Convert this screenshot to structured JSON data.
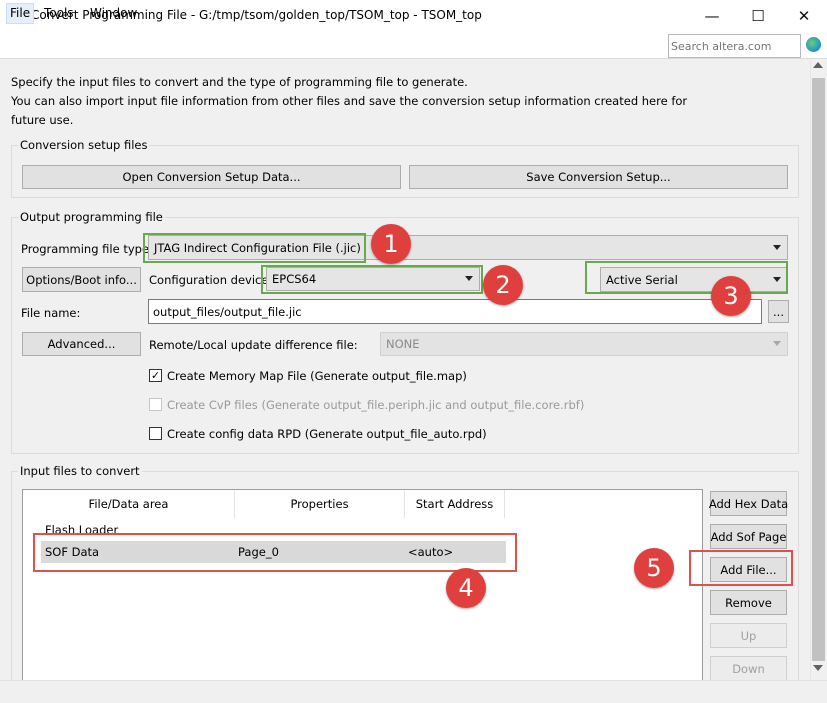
{
  "window": {
    "title": "Convert Programming File - G:/tmp/tsom/golden_top/TSOM_top - TSOM_top",
    "minimize_glyph": "—",
    "maximize_glyph": "☐",
    "close_glyph": "✕"
  },
  "menu": {
    "items": [
      "File",
      "Tools",
      "Window"
    ],
    "search_placeholder": "Search altera.com"
  },
  "intro": {
    "line1": "Specify the input files to convert and the type of programming file to generate.",
    "line2": "You can also import input file information from other files and save the conversion setup information created here for",
    "line3": "future use."
  },
  "conversion_setup": {
    "title": "Conversion setup files",
    "open_button": "Open Conversion Setup Data...",
    "save_button": "Save Conversion Setup..."
  },
  "output": {
    "title": "Output programming file",
    "file_type_label": "Programming file type:",
    "file_type_value": "JTAG Indirect Configuration File (.jic)",
    "options_button": "Options/Boot info...",
    "config_device_label": "Configuration device:",
    "config_device_value": "EPCS64",
    "mode_value": "Active Serial",
    "file_name_label": "File name:",
    "file_name_value": "output_files/output_file.jic",
    "browse_button": "...",
    "advanced_button": "Advanced...",
    "remote_label": "Remote/Local update difference file:",
    "remote_value": "NONE",
    "memory_map_label": "Create Memory Map File (Generate output_file.map)",
    "memory_map_checked": "✓",
    "cvp_label": "Create CvP files (Generate output_file.periph.jic and output_file.core.rbf)",
    "rpd_label": "Create config data RPD (Generate output_file_auto.rpd)"
  },
  "input_files": {
    "title": "Input files to convert",
    "columns": [
      "File/Data area",
      "Properties",
      "Start Address"
    ],
    "tree_root": "Flash Loader",
    "row": {
      "name": "SOF Data",
      "properties": "Page_0",
      "address": "<auto>"
    },
    "buttons": {
      "add_hex": "Add Hex Data",
      "add_sof": "Add Sof Page",
      "add_file": "Add File...",
      "remove": "Remove",
      "up": "Up",
      "down": "Down"
    }
  },
  "annotations": [
    "1",
    "2",
    "3",
    "4",
    "5"
  ],
  "colors": {
    "highlight_green": "#6aa84f",
    "highlight_red": "#d9534f",
    "marker_red": "#e0403d"
  }
}
